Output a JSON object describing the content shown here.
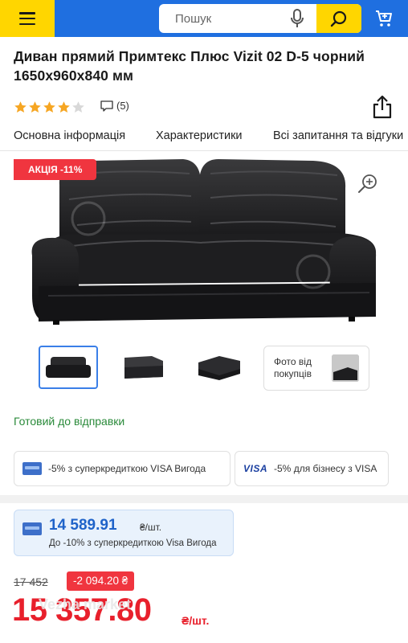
{
  "header": {
    "search_placeholder": "Пошук",
    "menu_icon": "hamburger-icon",
    "mic_icon": "microphone-icon",
    "search_icon": "search-icon",
    "cart_icon": "cart-icon",
    "colors": {
      "bar": "#1f6fe0",
      "accent": "#ffd600"
    }
  },
  "product": {
    "title": "Диван прямий Примтекс Плюс Vizit 02 D-5 чорний 1650x960x840 мм",
    "rating": 4,
    "rating_max": 5,
    "reviews_count": "(5)"
  },
  "tabs": [
    {
      "label": "Основна інформація"
    },
    {
      "label": "Характеристики"
    },
    {
      "label": "Всі запитання та відгуки"
    }
  ],
  "gallery": {
    "promo_label": "АКЦІЯ -11%",
    "buyer_photos_label": "Фото від покупців"
  },
  "availability": "Готовий до відправки",
  "offers": [
    {
      "icon": "card-icon",
      "text": "-5% з суперкредиткою VISA Вигода"
    },
    {
      "icon": "VISA",
      "text": "-5% для бізнесу з VISA"
    }
  ],
  "credit": {
    "price": "14 589.91",
    "unit": "₴/шт.",
    "note": "До -10% з суперкредиткою Visa Вигода"
  },
  "pricing": {
    "old_price": "17 452",
    "discount": "-2 094.20 ₴",
    "price": "15 357.80",
    "unit": "₴/шт.",
    "price_color": "#e8202c"
  },
  "watermark": "Vezha market"
}
